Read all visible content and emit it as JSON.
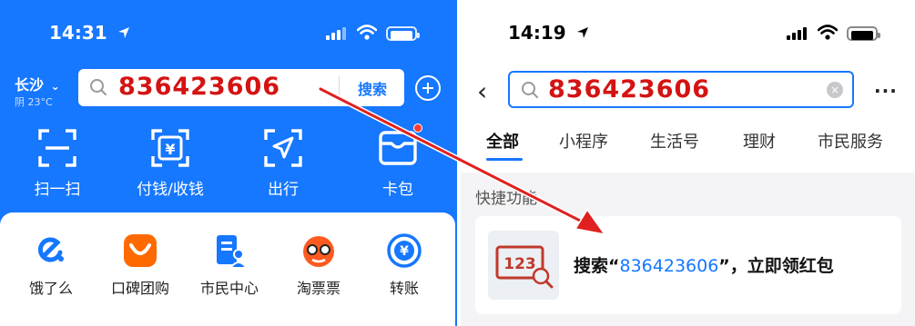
{
  "left": {
    "status": {
      "time": "14:31"
    },
    "city": "长沙",
    "weather": "阴 23°C",
    "search": {
      "query": "836423606",
      "button_label": "搜索"
    },
    "quick_actions": [
      {
        "label": "扫一扫",
        "icon": "scan-icon"
      },
      {
        "label": "付钱/收钱",
        "icon": "pay-icon"
      },
      {
        "label": "出行",
        "icon": "travel-icon"
      },
      {
        "label": "卡包",
        "icon": "card-wallet-icon"
      }
    ],
    "apps": [
      {
        "label": "饿了么",
        "icon": "eleme-icon"
      },
      {
        "label": "口碑团购",
        "icon": "koubei-icon"
      },
      {
        "label": "市民中心",
        "icon": "citizen-center-icon"
      },
      {
        "label": "淘票票",
        "icon": "taopiaopiao-icon"
      },
      {
        "label": "转账",
        "icon": "transfer-icon"
      }
    ]
  },
  "right": {
    "status": {
      "time": "14:19"
    },
    "search": {
      "query": "836423606"
    },
    "tabs": [
      "全部",
      "小程序",
      "生活号",
      "理财",
      "市民服务"
    ],
    "section_title": "快捷功能",
    "result": {
      "thumb_text": "123",
      "prefix": "搜索“",
      "highlight": "836423606",
      "suffix": "”，立即领红包"
    }
  },
  "colors": {
    "brand_blue": "#1677ff",
    "query_red": "#d41313",
    "arrow_red": "#e02020"
  }
}
